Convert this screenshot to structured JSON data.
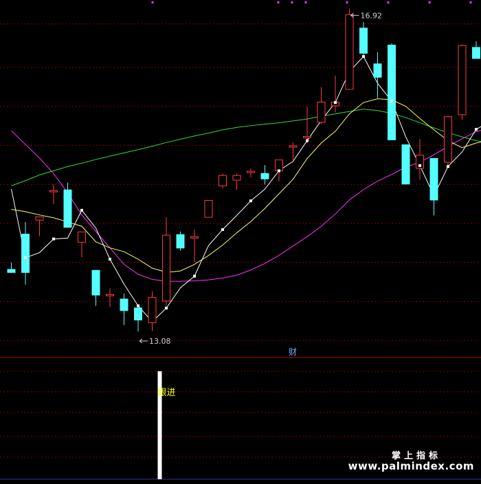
{
  "chart_data": {
    "type": "candlestick",
    "main_panel": {
      "candles": [
        {
          "o": 11.38,
          "h": 11.52,
          "l": 11.3,
          "c": 11.3
        },
        {
          "o": 12.13,
          "h": 12.38,
          "l": 11.05,
          "c": 11.3
        },
        {
          "o": 12.42,
          "h": 12.49,
          "l": 12.08,
          "c": 12.49
        },
        {
          "o": 13.04,
          "h": 13.18,
          "l": 12.76,
          "c": 13.05
        },
        {
          "o": 13.07,
          "h": 13.22,
          "l": 12.26,
          "c": 12.26
        },
        {
          "o": 11.95,
          "h": 12.17,
          "l": 11.63,
          "c": 12.17
        },
        {
          "o": 11.36,
          "h": 11.36,
          "l": 10.6,
          "c": 10.82
        },
        {
          "o": 10.84,
          "h": 10.97,
          "l": 10.57,
          "c": 10.84
        },
        {
          "o": 10.75,
          "h": 10.86,
          "l": 10.19,
          "c": 10.49
        },
        {
          "o": 10.56,
          "h": 10.59,
          "l": 10.05,
          "c": 10.29
        },
        {
          "o": 10.24,
          "h": 10.91,
          "l": 10.06,
          "c": 10.78
        },
        {
          "o": 10.7,
          "h": 12.48,
          "l": 10.6,
          "c": 12.1
        },
        {
          "o": 12.12,
          "h": 12.18,
          "l": 11.77,
          "c": 11.82
        },
        {
          "o": 12.07,
          "h": 12.22,
          "l": 11.53,
          "c": 12.07
        },
        {
          "o": 12.48,
          "h": 12.84,
          "l": 12.48,
          "c": 12.84
        },
        {
          "o": 13.15,
          "h": 13.41,
          "l": 13.09,
          "c": 13.37
        },
        {
          "o": 13.27,
          "h": 13.41,
          "l": 13.06,
          "c": 13.37
        },
        {
          "o": 13.46,
          "h": 13.52,
          "l": 13.33,
          "c": 13.46
        },
        {
          "o": 13.42,
          "h": 13.59,
          "l": 13.18,
          "c": 13.29
        },
        {
          "o": 13.47,
          "h": 13.7,
          "l": 13.25,
          "c": 13.7
        },
        {
          "o": 14.0,
          "h": 14.07,
          "l": 13.65,
          "c": 14.0
        },
        {
          "o": 14.2,
          "h": 14.83,
          "l": 14.06,
          "c": 14.2
        },
        {
          "o": 14.5,
          "h": 15.25,
          "l": 14.46,
          "c": 14.93
        },
        {
          "o": 14.85,
          "h": 15.49,
          "l": 14.71,
          "c": 14.93
        },
        {
          "o": 15.2,
          "h": 16.92,
          "l": 15.2,
          "c": 16.79
        },
        {
          "o": 16.51,
          "h": 16.63,
          "l": 15.94,
          "c": 15.96
        },
        {
          "o": 15.75,
          "h": 15.99,
          "l": 15.02,
          "c": 15.45
        },
        {
          "o": 16.15,
          "h": 16.18,
          "l": 14.12,
          "c": 14.12
        },
        {
          "o": 14.03,
          "h": 14.03,
          "l": 13.18,
          "c": 13.18
        },
        {
          "o": 13.52,
          "h": 14.14,
          "l": 13.28,
          "c": 13.8
        },
        {
          "o": 13.74,
          "h": 13.74,
          "l": 12.52,
          "c": 12.84
        },
        {
          "o": 13.65,
          "h": 14.64,
          "l": 13.58,
          "c": 14.62
        },
        {
          "o": 14.66,
          "h": 16.16,
          "l": 14.55,
          "c": 16.13
        },
        {
          "o": 16.1,
          "h": 16.22,
          "l": 15.85,
          "c": 15.85
        },
        {
          "o": 14.89,
          "h": 15.21,
          "l": 14.91,
          "c": 15.22
        },
        {
          "o": 15.42,
          "h": 15.44,
          "l": 14.91,
          "c": 15.44
        }
      ],
      "white_ma": [
        13.08,
        11.62,
        11.73,
        12.02,
        12.04,
        12.63,
        12.25,
        11.59,
        11.06,
        10.6,
        10.26,
        10.55,
        10.98,
        11.23,
        11.88,
        12.22,
        12.52,
        12.83,
        13.08,
        13.47,
        13.67,
        14.11,
        14.54,
        14.92,
        15.58,
        15.9,
        15.33,
        14.95,
        14.19,
        13.58,
        12.94,
        13.56,
        13.87,
        14.35,
        14.52,
        14.54
      ],
      "yellow_ma": [
        12.65,
        12.6,
        12.53,
        12.47,
        12.38,
        12.29,
        11.96,
        11.83,
        11.75,
        11.59,
        11.4,
        11.31,
        11.34,
        11.48,
        11.67,
        11.89,
        12.15,
        12.39,
        12.67,
        12.98,
        13.29,
        13.73,
        14.06,
        14.31,
        14.68,
        14.92,
        15.0,
        14.98,
        14.84,
        14.58,
        14.34,
        14.11,
        13.96,
        14.06,
        14.12,
        14.13
      ],
      "magenta_ma": [
        14.32,
        14.03,
        13.74,
        13.41,
        13.0,
        12.53,
        12.18,
        11.83,
        11.48,
        11.27,
        11.16,
        11.12,
        11.12,
        11.13,
        11.15,
        11.19,
        11.25,
        11.36,
        11.5,
        11.67,
        11.87,
        12.07,
        12.29,
        12.55,
        12.85,
        13.07,
        13.25,
        13.39,
        13.55,
        13.65,
        13.81,
        13.99,
        14.15,
        14.3,
        14.38,
        14.47
      ],
      "green_ma": [
        13.15,
        13.26,
        13.38,
        13.47,
        13.56,
        13.63,
        13.71,
        13.78,
        13.85,
        13.92,
        13.99,
        14.07,
        14.14,
        14.21,
        14.27,
        14.34,
        14.39,
        14.43,
        14.46,
        14.49,
        14.53,
        14.57,
        14.63,
        14.68,
        14.73,
        14.78,
        14.75,
        14.69,
        14.6,
        14.49,
        14.38,
        14.28,
        14.19,
        14.11,
        14.06,
        14.02
      ],
      "y_range": [
        9.5,
        17.1
      ],
      "gridlines": [
        16.59,
        15.67,
        14.84,
        14.01,
        13.18,
        12.35,
        11.52,
        10.69,
        9.86
      ],
      "annotations": {
        "high_label": "16.92",
        "low_label": "13.08",
        "marker_text": "财"
      }
    },
    "sub_panel": {
      "signal_bars": [
        {
          "index": 10,
          "value": 1
        }
      ],
      "signal_label": "跟进"
    }
  },
  "watermark": {
    "cn": "掌上指标",
    "url": "www.palmindex.com"
  },
  "colors": {
    "up": "#ff3c3c",
    "down": "#54ffff",
    "white_line": "#ffffff",
    "yellow_line": "#ffff66",
    "magenta_line": "#ff33ff",
    "green_line": "#33dd33",
    "grid": "#8b0000",
    "label": "#d0d0d0",
    "signal_label": "#ffff00",
    "marker": "#6ab0ff"
  }
}
